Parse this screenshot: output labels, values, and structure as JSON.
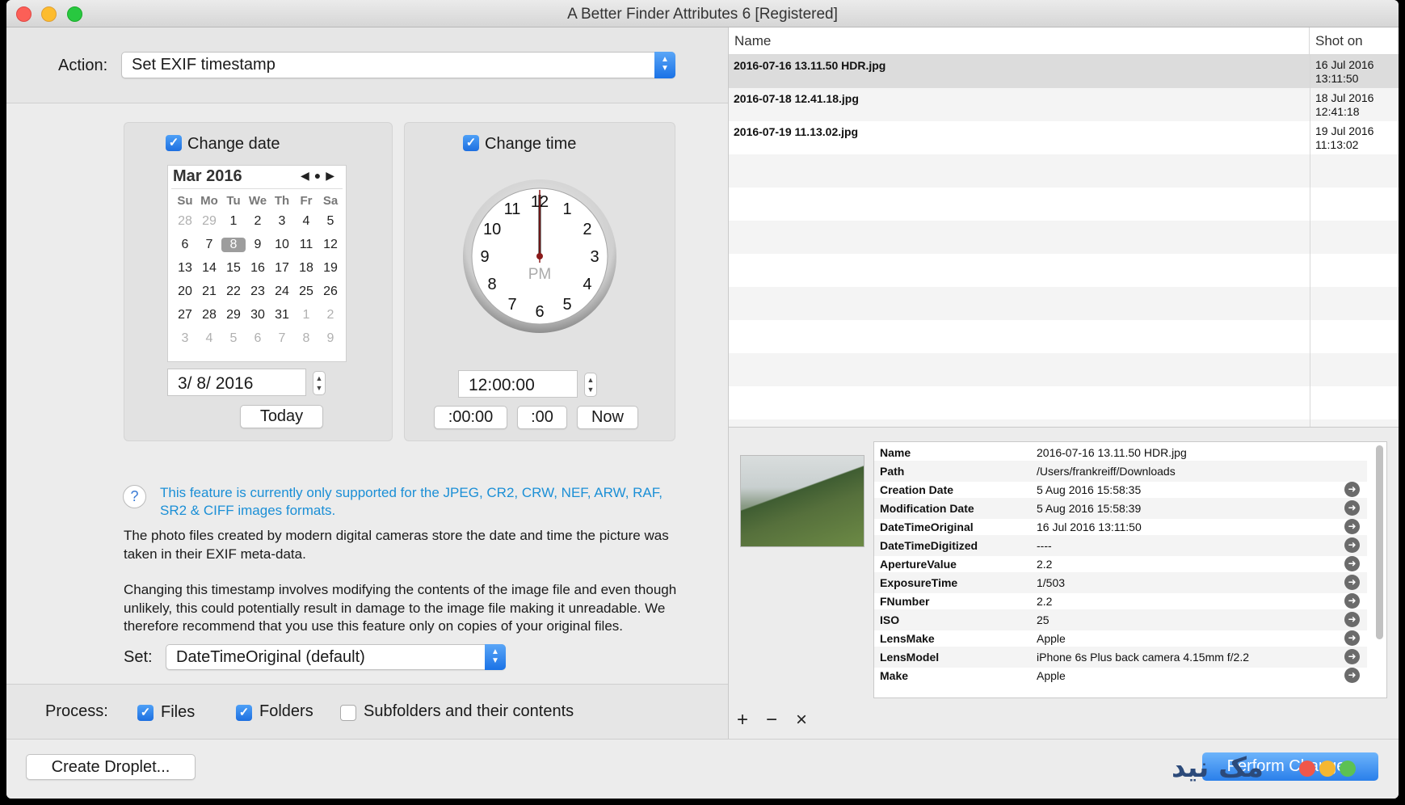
{
  "window": {
    "title": "A Better Finder Attributes 6 [Registered]"
  },
  "action": {
    "label": "Action:",
    "value": "Set EXIF timestamp"
  },
  "date_box": {
    "checkbox_label": "Change date",
    "checked": true,
    "month": "Mar 2016",
    "weekdays": [
      "Su",
      "Mo",
      "Tu",
      "We",
      "Th",
      "Fr",
      "Sa"
    ],
    "weeks": [
      [
        "28",
        "29",
        "1",
        "2",
        "3",
        "4",
        "5"
      ],
      [
        "6",
        "7",
        "8",
        "9",
        "10",
        "11",
        "12"
      ],
      [
        "13",
        "14",
        "15",
        "16",
        "17",
        "18",
        "19"
      ],
      [
        "20",
        "21",
        "22",
        "23",
        "24",
        "25",
        "26"
      ],
      [
        "27",
        "28",
        "29",
        "30",
        "31",
        "1",
        "2"
      ],
      [
        "3",
        "4",
        "5",
        "6",
        "7",
        "8",
        "9"
      ]
    ],
    "selected_day": "8",
    "date_value": "3/  8/ 2016",
    "today_label": "Today"
  },
  "time_box": {
    "checkbox_label": "Change time",
    "checked": true,
    "clock_numbers": [
      "12",
      "1",
      "2",
      "3",
      "4",
      "5",
      "6",
      "7",
      "8",
      "9",
      "10",
      "11"
    ],
    "clock_ampm": "PM",
    "time_value": "12:00:00",
    "btn_seconds": ":00:00",
    "btn_minutes": ":00",
    "btn_now": "Now"
  },
  "help": {
    "icon": "question-mark",
    "notice": "This feature is currently only supported for the JPEG, CR2, CRW, NEF, ARW, RAF, SR2 & CIFF images formats."
  },
  "paragraph1": "The photo files created by modern digital cameras store the date and time the picture was taken in their EXIF meta-data.",
  "paragraph2": "Changing this timestamp involves modifying the contents of the image file and even though unlikely, this could potentially result in damage to the image file making it unreadable. We therefore recommend that you use this feature only on copies of your original files.",
  "set": {
    "label": "Set:",
    "value": "DateTimeOriginal (default)"
  },
  "process": {
    "label": "Process:",
    "files": "Files",
    "files_checked": true,
    "folders": "Folders",
    "folders_checked": true,
    "subfolders": "Subfolders and their contents",
    "subfolders_checked": false
  },
  "bottom": {
    "create_droplet": "Create Droplet...",
    "perform": "Perform Changes",
    "watermark": "مک نید"
  },
  "file_table": {
    "headers": [
      "Name",
      "Shot on"
    ],
    "rows": [
      {
        "name": "2016-07-16 13.11.50 HDR.jpg",
        "date": "16 Jul 2016",
        "time": "13:11:50"
      },
      {
        "name": "2016-07-18 12.41.18.jpg",
        "date": "18 Jul 2016",
        "time": "12:41:18"
      },
      {
        "name": "2016-07-19 11.13.02.jpg",
        "date": "19 Jul 2016",
        "time": "11:13:02"
      }
    ]
  },
  "info_table": [
    {
      "key": "Name",
      "value": "2016-07-16 13.11.50 HDR.jpg",
      "arrow": false
    },
    {
      "key": "Path",
      "value": "/Users/frankreiff/Downloads",
      "arrow": false
    },
    {
      "key": "Creation Date",
      "value": "5 Aug 2016 15:58:35",
      "arrow": true
    },
    {
      "key": "Modification Date",
      "value": "5 Aug 2016 15:58:39",
      "arrow": true
    },
    {
      "key": "DateTimeOriginal",
      "value": "16 Jul 2016 13:11:50",
      "arrow": true
    },
    {
      "key": "DateTimeDigitized",
      "value": "----",
      "arrow": true
    },
    {
      "key": "ApertureValue",
      "value": "2.2",
      "arrow": true
    },
    {
      "key": "ExposureTime",
      "value": "1/503",
      "arrow": true
    },
    {
      "key": "FNumber",
      "value": "2.2",
      "arrow": true
    },
    {
      "key": "ISO",
      "value": "25",
      "arrow": true
    },
    {
      "key": "LensMake",
      "value": "Apple",
      "arrow": true
    },
    {
      "key": "LensModel",
      "value": "iPhone 6s Plus back camera 4.15mm f/2.2",
      "arrow": true
    },
    {
      "key": "Make",
      "value": "Apple",
      "arrow": true
    }
  ],
  "toolbar": {
    "add": "+",
    "remove": "−",
    "clear": "×"
  },
  "colors": {
    "accent": "#1d6fe0",
    "notice_text": "#1b8fd6",
    "selection": "#9d9d9d"
  }
}
